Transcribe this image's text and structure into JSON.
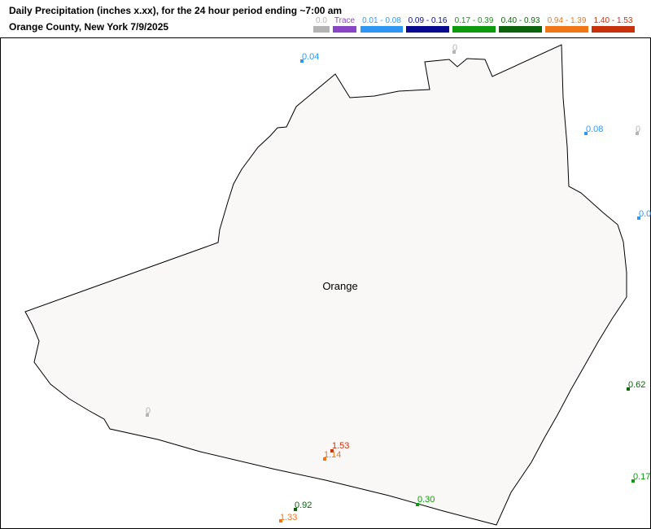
{
  "header": {
    "title_line1": "Daily Precipitation (inches  x.xx),  for the 24 hour period ending ~7:00 am",
    "title_line2": "Orange County, New York  7/9/2025"
  },
  "legend": [
    {
      "label": "0.0",
      "color": "#b4b4b4",
      "text_color": "#b4b4b4"
    },
    {
      "label": "Trace",
      "color": "#8a44c6",
      "text_color": "#8a44c6"
    },
    {
      "label": "0.01 - 0.08",
      "color": "#2e97f4",
      "text_color": "#2e97f4"
    },
    {
      "label": "0.09 - 0.16",
      "color": "#080890",
      "text_color": "#080890"
    },
    {
      "label": "0.17 - 0.39",
      "color": "#0d9a0d",
      "text_color": "#0d9a0d"
    },
    {
      "label": "0.40 - 0.93",
      "color": "#0b630b",
      "text_color": "#0b630b"
    },
    {
      "label": "0.94 - 1.39",
      "color": "#f07616",
      "text_color": "#f07616"
    },
    {
      "label": "1.40 - 1.53",
      "color": "#c8310a",
      "text_color": "#c8310a"
    }
  ],
  "map": {
    "county_name": "Orange",
    "county_fill": "#f9f8f6",
    "stations": [
      {
        "label": "0.04",
        "color": "#2e97f4"
      },
      {
        "label": "0",
        "color": "#b4b4b4"
      },
      {
        "label": "0.08",
        "color": "#2e97f4"
      },
      {
        "label": "0",
        "color": "#b4b4b4"
      },
      {
        "label": "0.0",
        "color": "#2e97f4"
      },
      {
        "label": "0.62",
        "color": "#0b630b"
      },
      {
        "label": "0.17",
        "color": "#0d9a0d"
      },
      {
        "label": "0",
        "color": "#b4b4b4"
      },
      {
        "label": "1.53",
        "color": "#c8310a"
      },
      {
        "label": "1.14",
        "color": "#f07616"
      },
      {
        "label": "0.30",
        "color": "#0d9a0d"
      },
      {
        "label": "0.92",
        "color": "#0b630b"
      },
      {
        "label": "1.33",
        "color": "#f07616"
      }
    ]
  }
}
